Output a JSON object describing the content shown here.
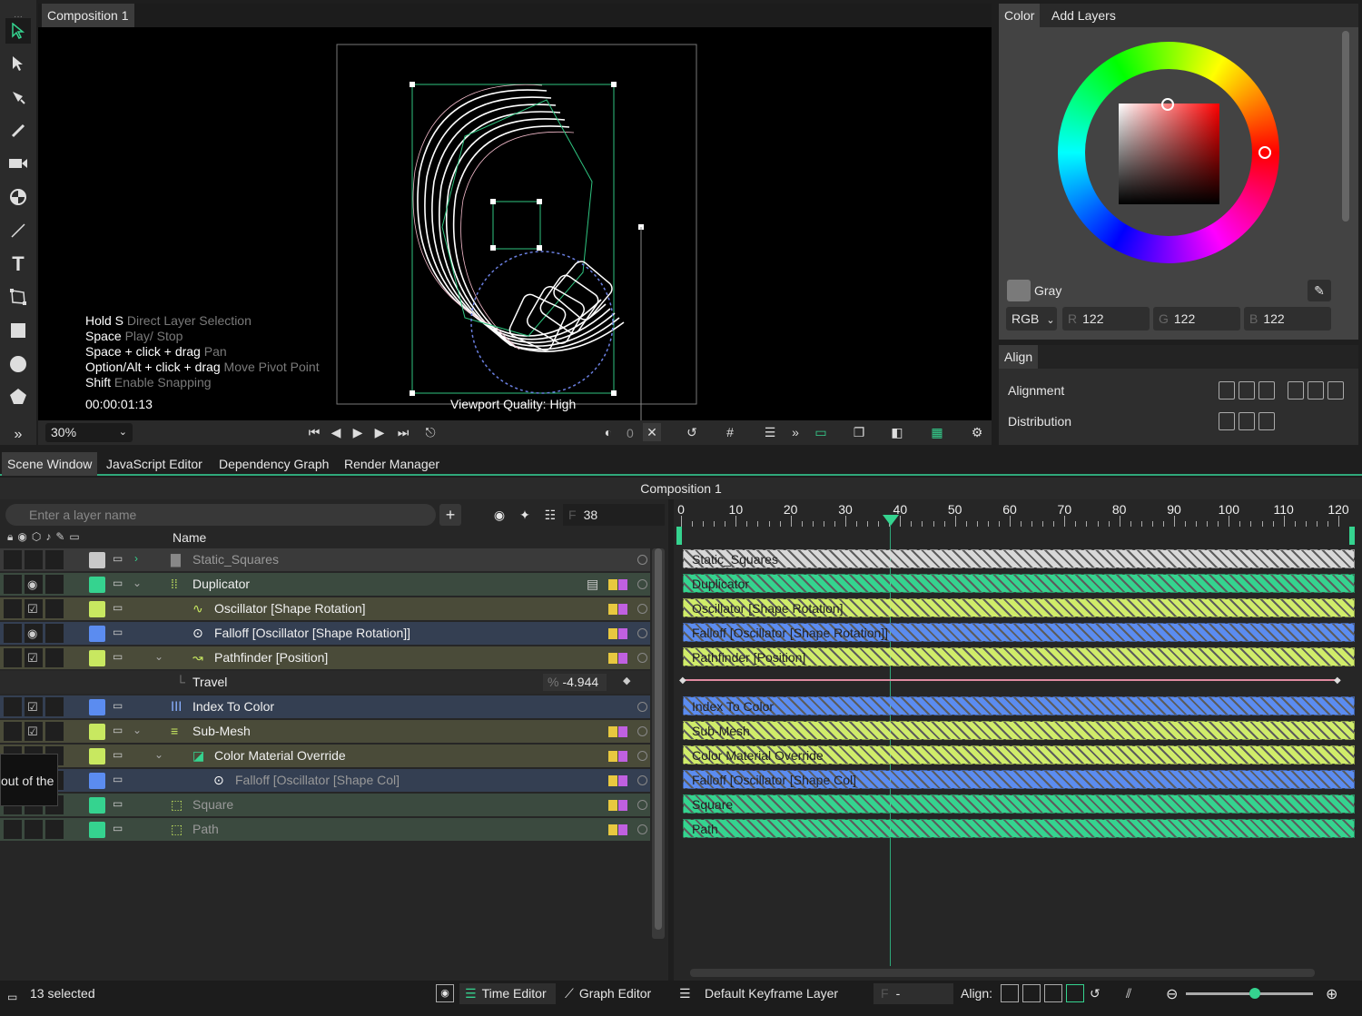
{
  "toolbar": {
    "tools": [
      "select-icon",
      "direct-select-icon",
      "pen-icon",
      "pencil-icon",
      "camera-icon",
      "null-icon",
      "line-icon",
      "text-icon",
      "transform-icon",
      "rectangle-icon",
      "ellipse-icon",
      "polygon-icon",
      "expand-icon"
    ]
  },
  "viewport": {
    "tab": "Composition 1",
    "hints": [
      {
        "key": "Hold S",
        "action": "Direct Layer Selection"
      },
      {
        "key": "Space",
        "action": "Play/ Stop"
      },
      {
        "key": "Space + click + drag",
        "action": "Pan"
      },
      {
        "key": "Option/Alt + click + drag",
        "action": "Move Pivot Point"
      },
      {
        "key": "Shift",
        "action": "Enable Snapping"
      }
    ],
    "timecode": "00:00:01:13",
    "quality": "Viewport Quality: High",
    "zoom": "30%",
    "frame_count": "0"
  },
  "color_panel": {
    "tabs": [
      "Color",
      "Add Layers"
    ],
    "swatch_name": "Gray",
    "swatch_color": "#7a7a7a",
    "mode": "RGB",
    "r_label": "R",
    "r": "122",
    "g_label": "G",
    "g": "122",
    "b_label": "B",
    "b": "122"
  },
  "align_panel": {
    "title": "Align",
    "alignment_label": "Alignment",
    "distribution_label": "Distribution"
  },
  "lower_tabs": [
    "Scene Window",
    "JavaScript Editor",
    "Dependency Graph",
    "Render Manager"
  ],
  "composition_title": "Composition 1",
  "layers": {
    "search_placeholder": "Enter a layer name",
    "frame_label": "F",
    "frame": "38",
    "name_header": "Name",
    "rows": [
      {
        "name": "Static_Squares",
        "color": "#c8c8c8",
        "dim": true
      },
      {
        "name": "Duplicator",
        "color": "#35d38f",
        "dim": false
      },
      {
        "name": "Oscillator [Shape Rotation]",
        "color": "#c8e860",
        "dim": false
      },
      {
        "name": "Falloff [Oscillator [Shape Rotation]]",
        "color": "#5b8cf0",
        "dim": false
      },
      {
        "name": "Pathfinder [Position]",
        "color": "#c8e860",
        "dim": false
      },
      {
        "name": "Travel",
        "color": "",
        "dim": false
      },
      {
        "name": "Index To Color",
        "color": "#5b8cf0",
        "dim": false
      },
      {
        "name": "Sub-Mesh",
        "color": "#c8e860",
        "dim": false
      },
      {
        "name": "Color Material Override",
        "color": "#c8e860",
        "dim": false
      },
      {
        "name": "Falloff [Oscillator [Shape Col]",
        "color": "#5b8cf0",
        "dim": true
      },
      {
        "name": "Square",
        "color": "#35d38f",
        "dim": true
      },
      {
        "name": "Path",
        "color": "#35d38f",
        "dim": true
      }
    ],
    "travel_unit": "%",
    "travel_value": "-4.944",
    "tooltip": "out of the"
  },
  "timeline": {
    "ticks": [
      "0",
      "10",
      "20",
      "30",
      "40",
      "50",
      "60",
      "70",
      "80",
      "90",
      "100",
      "110",
      "120"
    ],
    "bars": [
      {
        "name": "Static_Squares",
        "color": "#d8d8d8"
      },
      {
        "name": "Duplicator",
        "color": "#35d38f"
      },
      {
        "name": "Oscillator [Shape Rotation]",
        "color": "#d0ec6a"
      },
      {
        "name": "Falloff [Oscillator [Shape Rotation]]",
        "color": "#5b8cf0"
      },
      {
        "name": "Pathfinder [Position]",
        "color": "#d0ec6a"
      },
      {
        "name": "",
        "color": ""
      },
      {
        "name": "Index To Color",
        "color": "#5b8cf0"
      },
      {
        "name": "Sub-Mesh",
        "color": "#d0ec6a"
      },
      {
        "name": "Color Material Override",
        "color": "#d0ec6a"
      },
      {
        "name": "Falloff [Oscillator [Shape Col]",
        "color": "#5b8cf0"
      },
      {
        "name": "Square",
        "color": "#35d38f"
      },
      {
        "name": "Path",
        "color": "#35d38f"
      }
    ]
  },
  "status": {
    "selected": "13 selected",
    "time_editor": "Time Editor",
    "graph_editor": "Graph Editor",
    "keyframe_layer": "Default Keyframe Layer",
    "f_label": "F",
    "f_value": "-",
    "align_label": "Align:"
  }
}
